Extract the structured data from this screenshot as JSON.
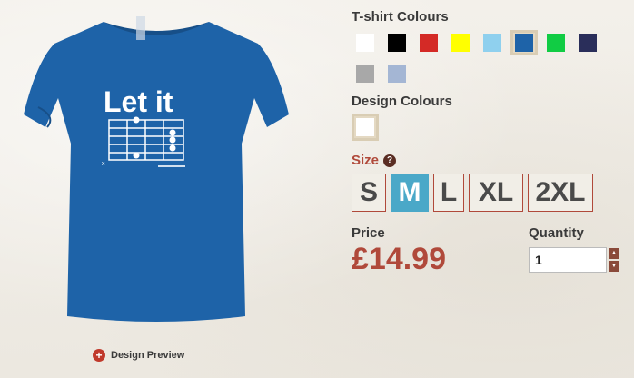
{
  "product": {
    "shirt_color": "#1e63a8",
    "print_text": "Let it",
    "preview_link": "Design Preview"
  },
  "tshirt_colours": {
    "title": "T-shirt Colours",
    "swatches": [
      {
        "name": "white",
        "color": "#ffffff",
        "selected": false
      },
      {
        "name": "black",
        "color": "#000000",
        "selected": false
      },
      {
        "name": "red",
        "color": "#d42a26",
        "selected": false
      },
      {
        "name": "yellow",
        "color": "#ffff00",
        "selected": false
      },
      {
        "name": "light-blue",
        "color": "#8fd0ee",
        "selected": false
      },
      {
        "name": "royal-blue",
        "color": "#1e63a8",
        "selected": true
      },
      {
        "name": "green",
        "color": "#11cc44",
        "selected": false
      },
      {
        "name": "navy",
        "color": "#2a2e5a",
        "selected": false
      },
      {
        "name": "grey",
        "color": "#a8a8a8",
        "selected": false
      },
      {
        "name": "powder-blue",
        "color": "#a4b6d4",
        "selected": false
      }
    ]
  },
  "design_colours": {
    "title": "Design Colours",
    "selected_color": "#ffffff"
  },
  "size": {
    "label": "Size",
    "help": "?",
    "options": [
      {
        "label": "S",
        "selected": false
      },
      {
        "label": "M",
        "selected": true
      },
      {
        "label": "L",
        "selected": false
      },
      {
        "label": "XL",
        "selected": false
      },
      {
        "label": "2XL",
        "selected": false
      }
    ]
  },
  "price": {
    "label": "Price",
    "value": "£14.99"
  },
  "quantity": {
    "label": "Quantity",
    "value": "1",
    "up": "▲",
    "down": "▼"
  },
  "colors": {
    "accent": "#b0493a",
    "selected_size": "#4aa8c8"
  }
}
